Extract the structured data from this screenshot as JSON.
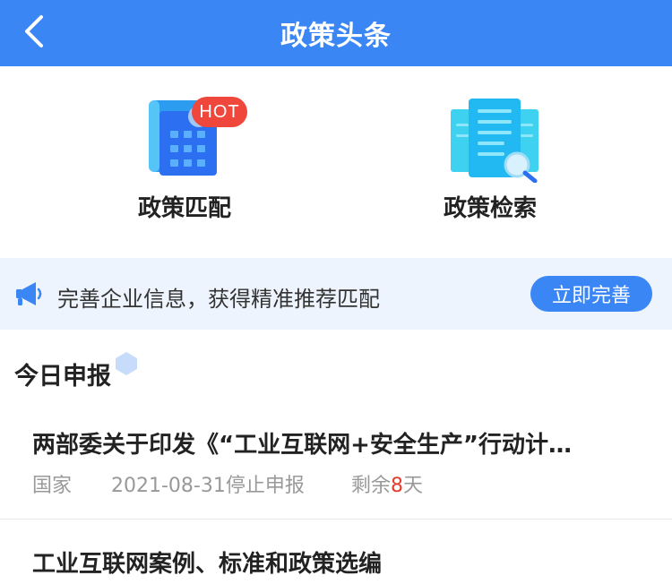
{
  "header": {
    "title": "政策头条"
  },
  "tools": [
    {
      "label": "政策匹配",
      "badge": "HOT"
    },
    {
      "label": "政策检索"
    }
  ],
  "banner": {
    "text": "完善企业信息，获得精准推荐匹配",
    "button_label": "立即完善"
  },
  "section": {
    "title": "今日申报"
  },
  "items": [
    {
      "title": "两部委关于印发《“工业互联网+安全生产”行动计…",
      "region": "国家",
      "deadline": "2021-08-31停止申报",
      "remaining_prefix": "剩余",
      "remaining_days": "8",
      "remaining_suffix": "天"
    },
    {
      "title": "工业互联网案例、标准和政策选编"
    }
  ],
  "colors": {
    "accent": "#3a86f5",
    "hot": "#f0473c",
    "deadline_days": "#e53a2e"
  }
}
